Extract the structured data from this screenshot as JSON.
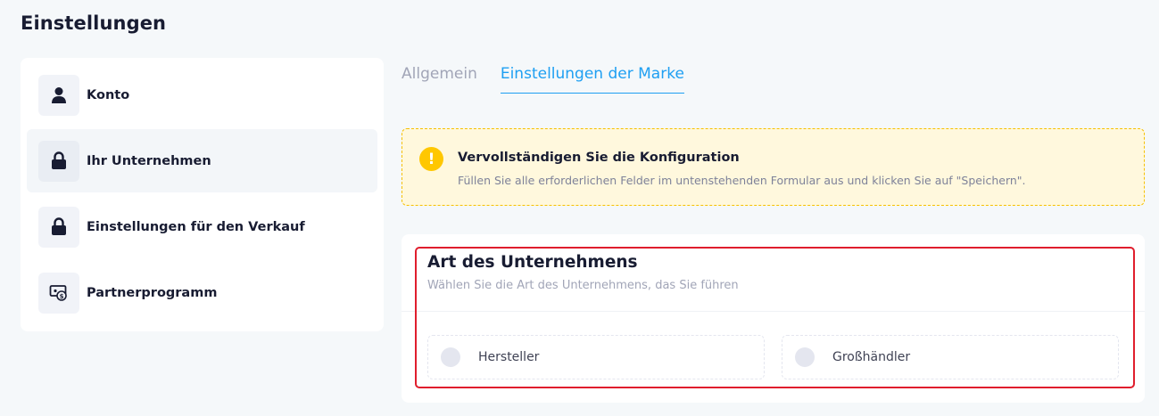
{
  "page": {
    "title": "Einstellungen"
  },
  "sidebar": {
    "items": [
      {
        "label": "Konto",
        "icon": "user-icon",
        "active": false
      },
      {
        "label": "Ihr Unternehmen",
        "icon": "lock-icon",
        "active": true
      },
      {
        "label": "Einstellungen für den Verkauf",
        "icon": "lock-icon",
        "active": false
      },
      {
        "label": "Partnerprogramm",
        "icon": "money-icon",
        "active": false
      }
    ]
  },
  "tabs": [
    {
      "label": "Allgemein",
      "active": false
    },
    {
      "label": "Einstellungen der Marke",
      "active": true
    }
  ],
  "notice": {
    "icon": "!",
    "title": "Vervollständigen Sie die Konfiguration",
    "text": "Füllen Sie alle erforderlichen Felder im untenstehenden Formular aus und klicken Sie auf \"Speichern\"."
  },
  "business_type": {
    "title": "Art des Unternehmens",
    "subtitle": "Wählen Sie die Art des Unternehmens, das Sie führen",
    "options": [
      {
        "label": "Hersteller",
        "selected": false
      },
      {
        "label": "Großhändler",
        "selected": false
      }
    ]
  },
  "colors": {
    "accent": "#1e9ff2",
    "warning": "#ffc700",
    "highlight_border": "#e01e2d"
  }
}
